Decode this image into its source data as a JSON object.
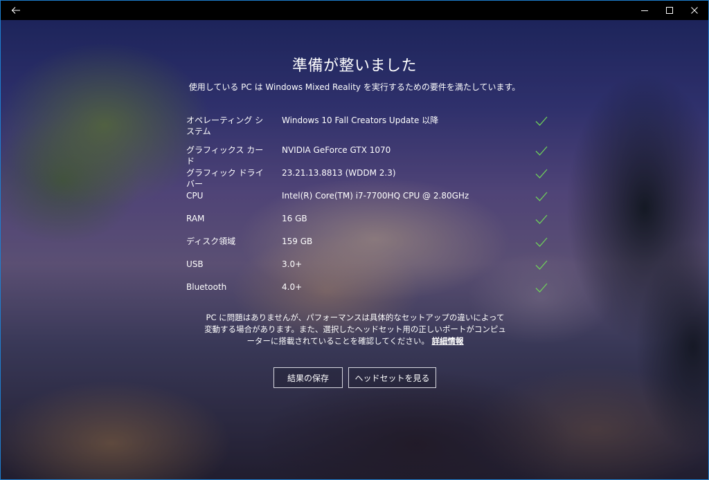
{
  "window": {
    "back_icon": "arrow-left-icon",
    "minimize_icon": "minimize-icon",
    "maximize_icon": "maximize-icon",
    "close_icon": "close-icon",
    "border_color": "#1e7fd0"
  },
  "main": {
    "title": "準備が整いました",
    "subtitle": "使用している PC は Windows Mixed Reality を実行するための要件を満たしています。",
    "requirements": [
      {
        "label": "オペレーティング システム",
        "value": "Windows 10 Fall Creators Update 以降",
        "status": "pass"
      },
      {
        "label": "グラフィックス カード",
        "value": "NVIDIA GeForce GTX 1070",
        "status": "pass"
      },
      {
        "label": "グラフィック ドライバー",
        "value": "23.21.13.8813 (WDDM 2.3)",
        "status": "pass"
      },
      {
        "label": "CPU",
        "value": "Intel(R) Core(TM) i7-7700HQ CPU @ 2.80GHz",
        "status": "pass"
      },
      {
        "label": "RAM",
        "value": "16 GB",
        "status": "pass"
      },
      {
        "label": "ディスク領域",
        "value": "159 GB",
        "status": "pass"
      },
      {
        "label": "USB",
        "value": "3.0+",
        "status": "pass"
      },
      {
        "label": "Bluetooth",
        "value": "4.0+",
        "status": "pass"
      }
    ],
    "check_color": "#6fcf5a",
    "note_text": "PC に問題はありませんが、パフォーマンスは具体的なセットアップの違いによって変動する場合があります。また、選択したヘッドセット用の正しいポートがコンピューターに搭載されていることを確認してください。",
    "note_link": "詳細情報",
    "save_button": "結果の保存",
    "headset_button": "ヘッドセットを見る"
  }
}
